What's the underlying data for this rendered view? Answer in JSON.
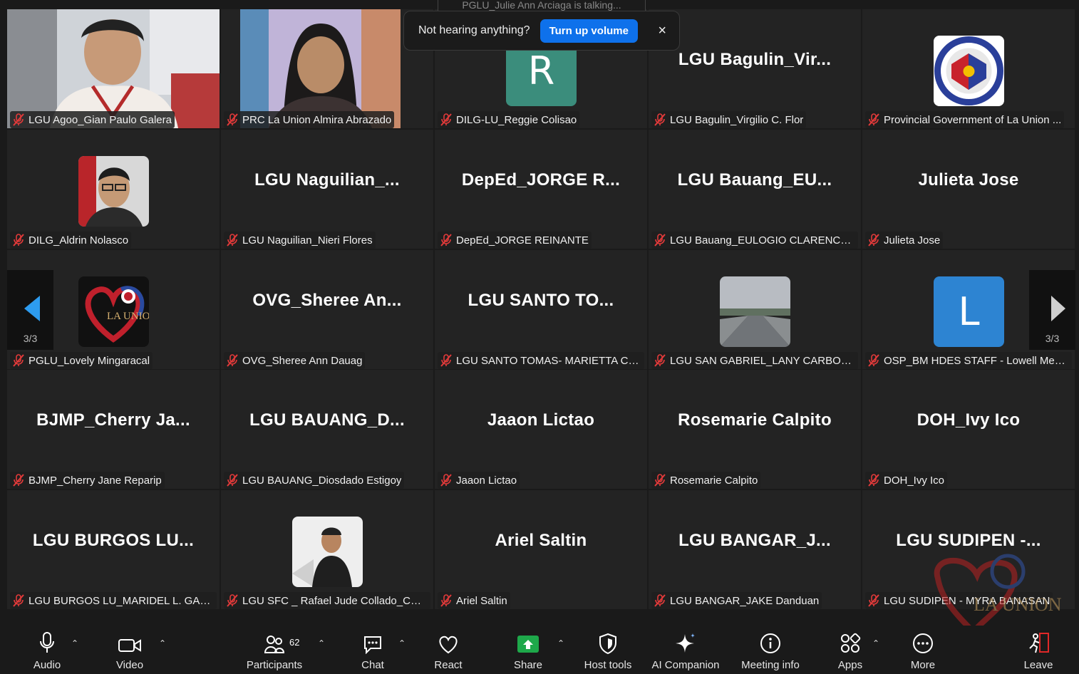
{
  "talking_banner": "PGLU_Julie Ann Arciaga is talking...",
  "toast": {
    "question": "Not hearing anything?",
    "button": "Turn up volume",
    "close": "×"
  },
  "pagination": {
    "left_page": "3/3",
    "right_page": "3/3"
  },
  "tiles": [
    {
      "label": "LGU Agoo_Gian Paulo Galera",
      "center": "",
      "kind": "photo-full"
    },
    {
      "label": "PRC La Union Almira Abrazado",
      "center": "",
      "kind": "photo-center"
    },
    {
      "label": "DILG-LU_Reggie Colisao",
      "center": "",
      "kind": "letter",
      "letter": "R",
      "color": "#3b8d7c"
    },
    {
      "label": "LGU Bagulin_Virgilio C. Flor",
      "center": "LGU  Bagulin_Vir...",
      "kind": "name"
    },
    {
      "label": "Provincial Government of La Union ...",
      "center": "",
      "kind": "seal"
    },
    {
      "label": "DILG_Aldrin Nolasco",
      "center": "",
      "kind": "thumb-person"
    },
    {
      "label": "LGU Naguilian_Nieri Flores",
      "center": "LGU  Naguilian_...",
      "kind": "name"
    },
    {
      "label": "DepEd_JORGE REINANTE",
      "center": "DepEd_JORGE  R...",
      "kind": "name"
    },
    {
      "label": "LGU Bauang_EULOGIO CLARENCE M...",
      "center": "LGU  Bauang_EU...",
      "kind": "name"
    },
    {
      "label": "Julieta Jose",
      "center": "Julieta Jose",
      "kind": "name"
    },
    {
      "label": "PGLU_Lovely Mingaracal",
      "center": "",
      "kind": "heart",
      "heart_text": "LA UNIO"
    },
    {
      "label": "OVG_Sheree Ann Dauag",
      "center": "OVG_Sheree  An...",
      "kind": "name"
    },
    {
      "label": "LGU SANTO TOMAS- MARIETTA CAR...",
      "center": "LGU  SANTO  TO...",
      "kind": "name"
    },
    {
      "label": "LGU SAN GABRIEL_LANY CARBONELL",
      "center": "",
      "kind": "road"
    },
    {
      "label": "OSP_BM HDES STAFF - Lowell Mend...",
      "center": "",
      "kind": "letter",
      "letter": "L",
      "color": "#2d84d2"
    },
    {
      "label": "BJMP_Cherry Jane Reparip",
      "center": "BJMP_Cherry  Ja...",
      "kind": "name"
    },
    {
      "label": "LGU BAUANG_Diosdado Estigoy",
      "center": "LGU  BAUANG_D...",
      "kind": "name"
    },
    {
      "label": "Jaaon Lictao",
      "center": "Jaaon Lictao",
      "kind": "name"
    },
    {
      "label": "Rosemarie Calpito",
      "center": "Rosemarie Calpito",
      "kind": "name"
    },
    {
      "label": "DOH_Ivy Ico",
      "center": "DOH_Ivy Ico",
      "kind": "name"
    },
    {
      "label": "LGU BURGOS LU_MARIDEL L. GABINO",
      "center": "LGU  BURGOS  LU...",
      "kind": "name"
    },
    {
      "label": "LGU SFC _ Rafael Jude Collado_CADA...",
      "center": "",
      "kind": "thumb-man"
    },
    {
      "label": "Ariel Saltin",
      "center": "Ariel Saltin",
      "kind": "name"
    },
    {
      "label": "LGU BANGAR_JAKE Danduan",
      "center": "LGU  BANGAR_J...",
      "kind": "name"
    },
    {
      "label": "LGU SUDIPEN - MYRA BANASAN",
      "center": "LGU  SUDIPEN  -...",
      "kind": "name"
    }
  ],
  "toolbar": {
    "audio": "Audio",
    "video": "Video",
    "participants": "Participants",
    "participants_count": "62",
    "chat": "Chat",
    "react": "React",
    "share": "Share",
    "host_tools": "Host tools",
    "ai_companion": "AI Companion",
    "meeting_info": "Meeting info",
    "apps": "Apps",
    "more": "More",
    "leave": "Leave"
  }
}
